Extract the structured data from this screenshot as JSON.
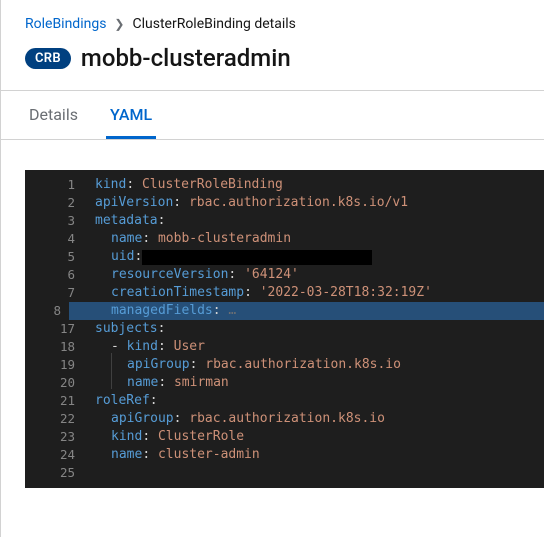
{
  "breadcrumb": {
    "root": "RoleBindings",
    "current": "ClusterRoleBinding details"
  },
  "badge": "CRB",
  "title": "mobb-clusteradmin",
  "tabs": {
    "details": "Details",
    "yaml": "YAML"
  },
  "editor": {
    "gutter": [
      "1",
      "2",
      "3",
      "4",
      "5",
      "6",
      "7",
      "8",
      "17",
      "18",
      "19",
      "20",
      "21",
      "22",
      "23",
      "24",
      "25"
    ],
    "fold_row_index": 7,
    "lines": [
      {
        "hl": false,
        "indent": 0,
        "seg": [
          [
            "k",
            "kind"
          ],
          [
            "p",
            ": "
          ],
          [
            "s",
            "ClusterRoleBinding"
          ]
        ]
      },
      {
        "hl": false,
        "indent": 0,
        "seg": [
          [
            "k",
            "apiVersion"
          ],
          [
            "p",
            ": "
          ],
          [
            "s",
            "rbac.authorization.k8s.io/v1"
          ]
        ]
      },
      {
        "hl": false,
        "indent": 0,
        "seg": [
          [
            "k",
            "metadata"
          ],
          [
            "p",
            ":"
          ]
        ]
      },
      {
        "hl": false,
        "indent": 1,
        "seg": [
          [
            "k",
            "name"
          ],
          [
            "p",
            ": "
          ],
          [
            "s",
            "mobb-clusteradmin"
          ]
        ]
      },
      {
        "hl": false,
        "indent": 1,
        "seg": [
          [
            "k",
            "uid"
          ],
          [
            "p",
            ":"
          ],
          [
            "redact",
            ""
          ]
        ]
      },
      {
        "hl": false,
        "indent": 1,
        "seg": [
          [
            "k",
            "resourceVersion"
          ],
          [
            "p",
            ": "
          ],
          [
            "s",
            "'64124'"
          ]
        ]
      },
      {
        "hl": false,
        "indent": 1,
        "seg": [
          [
            "k",
            "creationTimestamp"
          ],
          [
            "p",
            ": "
          ],
          [
            "s",
            "'2022-03-28T18:32:19Z'"
          ]
        ]
      },
      {
        "hl": true,
        "indent": 1,
        "seg": [
          [
            "k",
            "managedFields"
          ],
          [
            "p",
            ":"
          ],
          [
            "ellipsis",
            " …"
          ]
        ]
      },
      {
        "hl": false,
        "indent": 0,
        "seg": [
          [
            "k",
            "subjects"
          ],
          [
            "p",
            ":"
          ]
        ]
      },
      {
        "hl": false,
        "indent": 1,
        "dash": true,
        "seg": [
          [
            "k",
            "kind"
          ],
          [
            "p",
            ": "
          ],
          [
            "s",
            "User"
          ]
        ]
      },
      {
        "hl": false,
        "indent": 2,
        "seg": [
          [
            "k",
            "apiGroup"
          ],
          [
            "p",
            ": "
          ],
          [
            "s",
            "rbac.authorization.k8s.io"
          ]
        ]
      },
      {
        "hl": false,
        "indent": 2,
        "seg": [
          [
            "k",
            "name"
          ],
          [
            "p",
            ": "
          ],
          [
            "s",
            "smirman"
          ]
        ]
      },
      {
        "hl": false,
        "indent": 0,
        "seg": [
          [
            "k",
            "roleRef"
          ],
          [
            "p",
            ":"
          ]
        ]
      },
      {
        "hl": false,
        "indent": 1,
        "seg": [
          [
            "k",
            "apiGroup"
          ],
          [
            "p",
            ": "
          ],
          [
            "s",
            "rbac.authorization.k8s.io"
          ]
        ]
      },
      {
        "hl": false,
        "indent": 1,
        "seg": [
          [
            "k",
            "kind"
          ],
          [
            "p",
            ": "
          ],
          [
            "s",
            "ClusterRole"
          ]
        ]
      },
      {
        "hl": false,
        "indent": 1,
        "seg": [
          [
            "k",
            "name"
          ],
          [
            "p",
            ": "
          ],
          [
            "s",
            "cluster-admin"
          ]
        ]
      },
      {
        "hl": false,
        "indent": 0,
        "seg": []
      }
    ]
  }
}
